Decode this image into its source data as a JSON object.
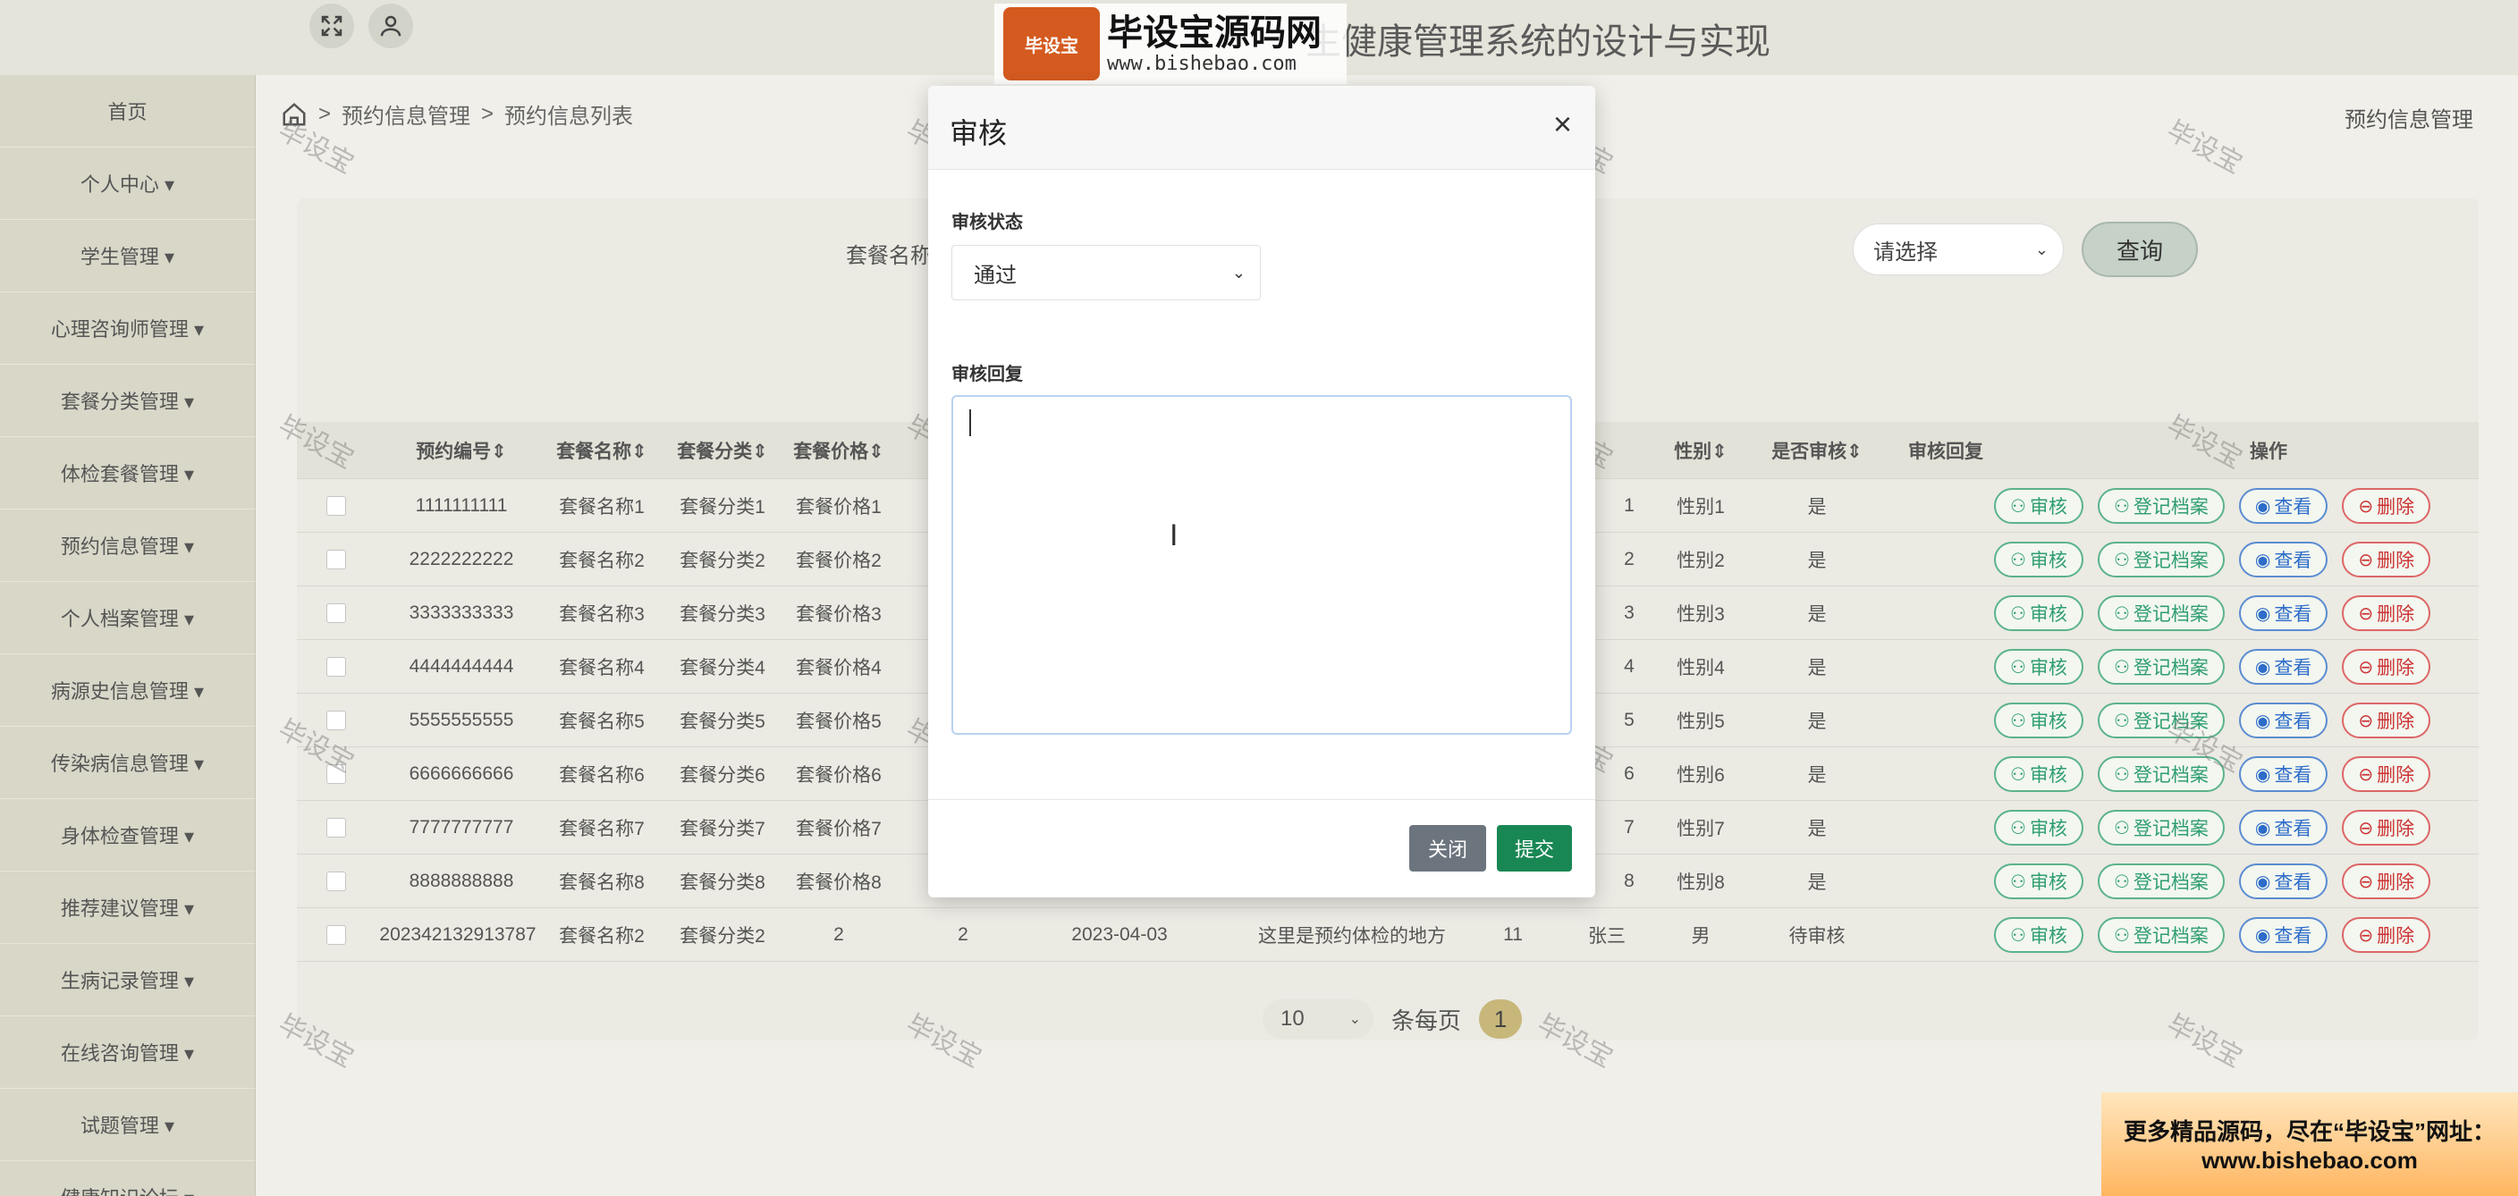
{
  "header": {
    "title": "生健康管理系统的设计与实现",
    "fullscreen_icon": "expand-icon",
    "user_icon": "user-icon"
  },
  "sidebar": {
    "items": [
      {
        "label": "首页"
      },
      {
        "label": "个人中心 ▾"
      },
      {
        "label": "学生管理 ▾"
      },
      {
        "label": "心理咨询师管理 ▾"
      },
      {
        "label": "套餐分类管理 ▾"
      },
      {
        "label": "体检套餐管理 ▾"
      },
      {
        "label": "预约信息管理 ▾"
      },
      {
        "label": "个人档案管理 ▾"
      },
      {
        "label": "病源史信息管理 ▾"
      },
      {
        "label": "传染病信息管理 ▾"
      },
      {
        "label": "身体检查管理 ▾"
      },
      {
        "label": "推荐建议管理 ▾"
      },
      {
        "label": "生病记录管理 ▾"
      },
      {
        "label": "在线咨询管理 ▾"
      },
      {
        "label": "试题管理 ▾"
      },
      {
        "label": "健康知识论坛 ▾"
      }
    ]
  },
  "breadcrumb": {
    "sep1": ">",
    "level1": "预约信息管理",
    "sep2": ">",
    "level2": "预约信息列表"
  },
  "page_right_title": "预约信息管理",
  "search": {
    "label": "套餐名称",
    "select_value": "请选择",
    "query_label": "查询"
  },
  "table": {
    "headers": [
      "预约编号⇕",
      "套餐名称⇕",
      "套餐分类⇕",
      "套餐价格⇕",
      "性别⇕",
      "是否审核⇕",
      "审核回复",
      "操作"
    ],
    "rows": [
      {
        "id": "1111111111",
        "name": "套餐名称1",
        "cat": "套餐分类1",
        "price": "套餐价格1",
        "n": "1",
        "sex": "性别1",
        "audit": "是"
      },
      {
        "id": "2222222222",
        "name": "套餐名称2",
        "cat": "套餐分类2",
        "price": "套餐价格2",
        "n": "2",
        "sex": "性别2",
        "audit": "是"
      },
      {
        "id": "3333333333",
        "name": "套餐名称3",
        "cat": "套餐分类3",
        "price": "套餐价格3",
        "n": "3",
        "sex": "性别3",
        "audit": "是"
      },
      {
        "id": "4444444444",
        "name": "套餐名称4",
        "cat": "套餐分类4",
        "price": "套餐价格4",
        "n": "4",
        "sex": "性别4",
        "audit": "是"
      },
      {
        "id": "5555555555",
        "name": "套餐名称5",
        "cat": "套餐分类5",
        "price": "套餐价格5",
        "n": "5",
        "sex": "性别5",
        "audit": "是"
      },
      {
        "id": "6666666666",
        "name": "套餐名称6",
        "cat": "套餐分类6",
        "price": "套餐价格6",
        "n": "6",
        "sex": "性别6",
        "audit": "是"
      },
      {
        "id": "7777777777",
        "name": "套餐名称7",
        "cat": "套餐分类7",
        "price": "套餐价格7",
        "n": "7",
        "sex": "性别7",
        "audit": "是"
      },
      {
        "id": "8888888888",
        "name": "套餐名称8",
        "cat": "套餐分类8",
        "price": "套餐价格8",
        "n": "8",
        "sex": "性别8",
        "audit": "是"
      }
    ],
    "last_row": {
      "id": "202342132913787",
      "name": "套餐名称2",
      "cat": "套餐分类2",
      "price": "2",
      "p2": "2",
      "date": "2023-04-03",
      "place": "这里是预约体检的地方",
      "n": "11",
      "person": "张三",
      "sex": "男",
      "audit": "待审核"
    },
    "op_labels": {
      "audit": "审核",
      "archive": "登记档案",
      "view": "查看",
      "delete": "删除"
    }
  },
  "pager": {
    "page_size": "10",
    "per_page_label": "条每页",
    "current_page": "1"
  },
  "modal": {
    "title": "审核",
    "close_glyph": "×",
    "status_label": "审核状态",
    "status_value": "通过",
    "reply_label": "审核回复",
    "reply_value": "",
    "close_button": "关闭",
    "submit_button": "提交"
  },
  "watermark": {
    "text": "毕设宝",
    "logo_badge": "毕设宝",
    "logo_cn": "毕设宝源码网",
    "logo_url": "www.bishebao.com"
  },
  "promo": {
    "line1": "更多精品源码，尽在“毕设宝”网址：",
    "line2": "www.bishebao.com"
  },
  "colors": {
    "sidebar_bg": "#d8d7c8",
    "accent_green": "#198754",
    "op_green": "#2f9e6e",
    "op_blue": "#2d6cc9",
    "op_red": "#c33"
  }
}
